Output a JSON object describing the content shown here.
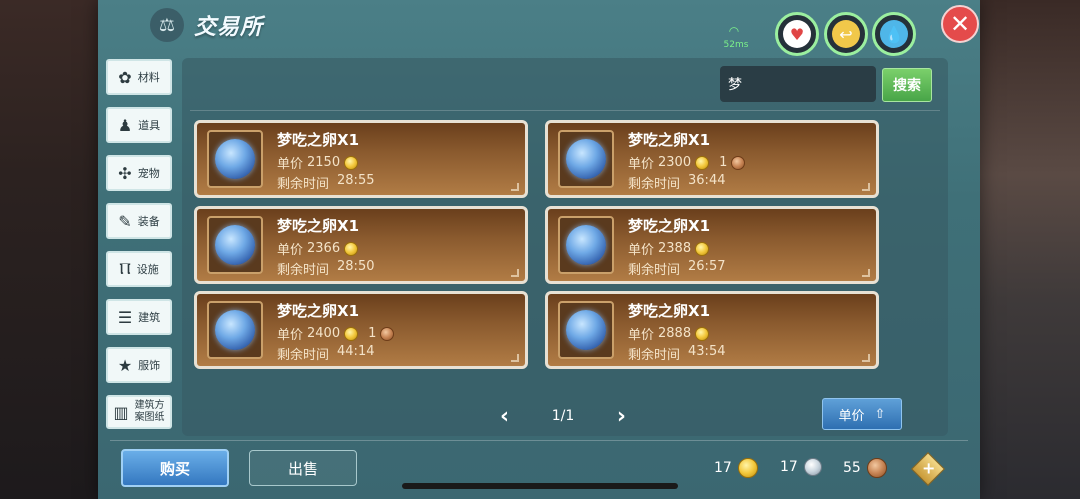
{
  "title": "交易所",
  "network": {
    "ping": "52ms"
  },
  "stats": [
    "heart-icon",
    "stamina-icon",
    "water-icon"
  ],
  "sidebar": {
    "items": [
      {
        "label": "材料",
        "icon": "materials-icon",
        "glyph": "✿"
      },
      {
        "label": "道具",
        "icon": "item-icon",
        "glyph": "♟"
      },
      {
        "label": "宠物",
        "icon": "paw-icon",
        "glyph": "✣"
      },
      {
        "label": "装备",
        "icon": "equipment-icon",
        "glyph": "✎"
      },
      {
        "label": "设施",
        "icon": "facility-icon",
        "glyph": "Ⲡ"
      },
      {
        "label": "建筑",
        "icon": "building-icon",
        "glyph": "☰"
      },
      {
        "label": "服饰",
        "icon": "clothing-icon",
        "glyph": "★"
      },
      {
        "label": "建筑方案图纸",
        "line1": "建筑方",
        "line2": "案图纸",
        "icon": "blueprint-icon",
        "glyph": "▥"
      }
    ]
  },
  "search": {
    "value": "梦",
    "button": "搜索"
  },
  "listings": [
    {
      "name": "梦吃之卵X1",
      "price_label": "单价",
      "price": "2150",
      "bronze": "",
      "time_label": "剩余时间",
      "time": "28:55"
    },
    {
      "name": "梦吃之卵X1",
      "price_label": "单价",
      "price": "2300",
      "bronze": "1",
      "time_label": "剩余时间",
      "time": "36:44"
    },
    {
      "name": "梦吃之卵X1",
      "price_label": "单价",
      "price": "2366",
      "bronze": "",
      "time_label": "剩余时间",
      "time": "28:50"
    },
    {
      "name": "梦吃之卵X1",
      "price_label": "单价",
      "price": "2388",
      "bronze": "",
      "time_label": "剩余时间",
      "time": "26:57"
    },
    {
      "name": "梦吃之卵X1",
      "price_label": "单价",
      "price": "2400",
      "bronze": "1",
      "time_label": "剩余时间",
      "time": "44:14"
    },
    {
      "name": "梦吃之卵X1",
      "price_label": "单价",
      "price": "2888",
      "bronze": "",
      "time_label": "剩余时间",
      "time": "43:54"
    }
  ],
  "pager": {
    "label": "1/1"
  },
  "sort": {
    "label": "单价"
  },
  "tabs": {
    "buy": "购买",
    "sell": "出售"
  },
  "currency": {
    "gold": "17",
    "silver": "17",
    "bronze": "55"
  },
  "colors": {
    "panel": "#4b7f87",
    "card": "#8a5a2e",
    "buy_button": "#3478c0",
    "search_button": "#48a548"
  }
}
